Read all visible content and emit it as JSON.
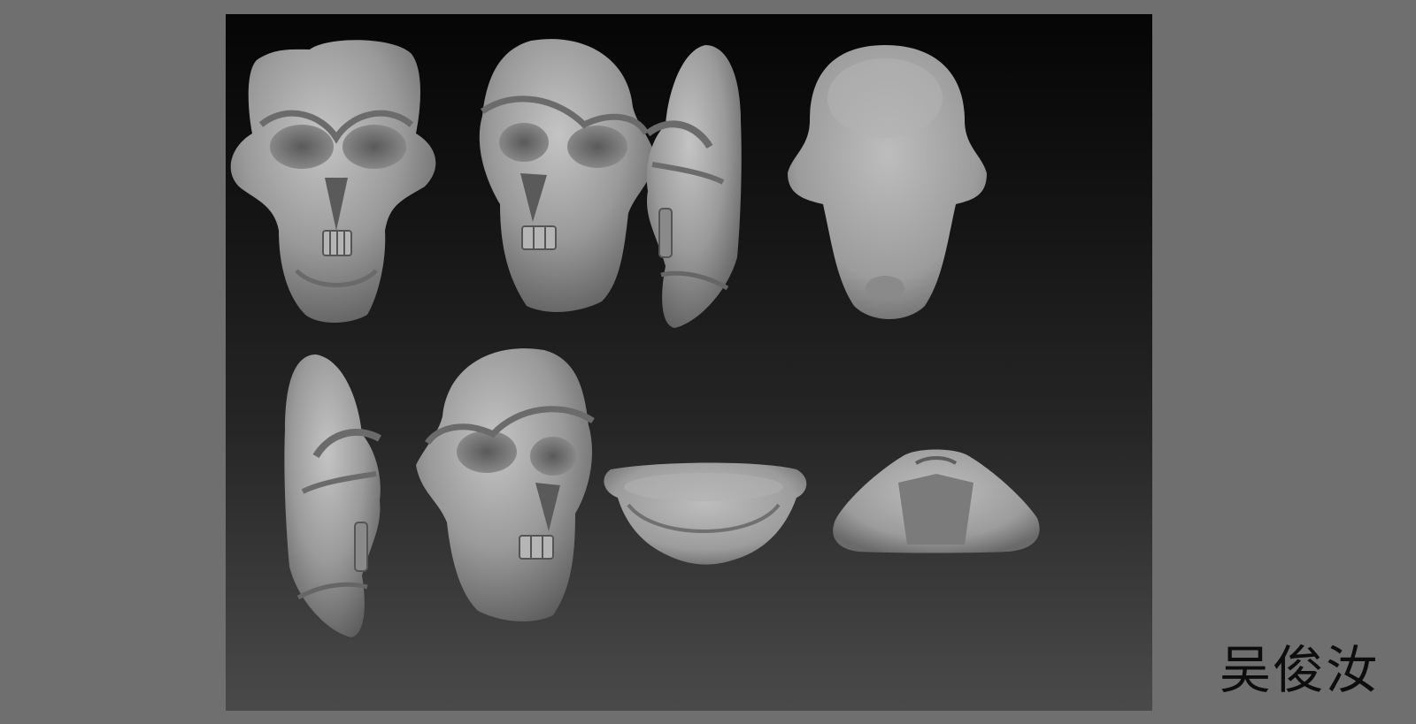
{
  "author": {
    "name": "吴俊汝"
  },
  "render_sheet": {
    "views": [
      {
        "name": "skull-front-view"
      },
      {
        "name": "skull-three-quarter-left-view"
      },
      {
        "name": "skull-side-right-view"
      },
      {
        "name": "skull-top-view"
      },
      {
        "name": "skull-side-left-view"
      },
      {
        "name": "skull-three-quarter-right-view"
      },
      {
        "name": "skull-rear-underside-view"
      },
      {
        "name": "skull-bottom-view"
      }
    ]
  }
}
